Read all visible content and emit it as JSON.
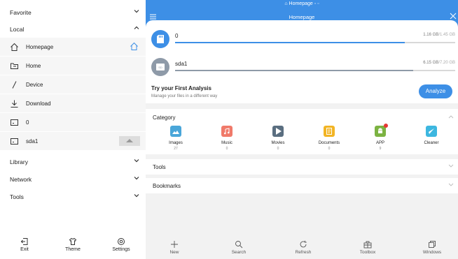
{
  "sidebar": {
    "favorite": "Favorite",
    "local": "Local",
    "items": [
      {
        "label": "Homepage",
        "icon": "home-icon"
      },
      {
        "label": "Home",
        "icon": "folder-icon"
      },
      {
        "label": "Device",
        "icon": "slash-icon"
      },
      {
        "label": "Download",
        "icon": "download-icon"
      },
      {
        "label": "0",
        "icon": "storage-icon"
      },
      {
        "label": "sda1",
        "icon": "storage-icon"
      }
    ],
    "library": "Library",
    "network": "Network",
    "tools": "Tools",
    "footer": {
      "exit": "Exit",
      "theme": "Theme",
      "settings": "Settings"
    }
  },
  "header": {
    "tab": "Homepage",
    "title": "Homepage"
  },
  "devices": [
    {
      "name": "0",
      "used": "1.16 GB",
      "total": "/1.45 GB",
      "fill": 0.82
    },
    {
      "name": "sda1",
      "used": "6.15 GB",
      "total": "/7.20 GB",
      "fill": 0.85
    }
  ],
  "analysis": {
    "title": "Try your First Analysis",
    "subtitle": "Manage your files in a different way",
    "button": "Analyze"
  },
  "category": {
    "title": "Category",
    "items": [
      {
        "label": "Images",
        "count": "27",
        "color": "#4aa6d9"
      },
      {
        "label": "Music",
        "count": "0",
        "color": "#f07a6a"
      },
      {
        "label": "Movies",
        "count": "0",
        "color": "#5a6e80"
      },
      {
        "label": "Documents",
        "count": "0",
        "color": "#f2b424"
      },
      {
        "label": "APP",
        "count": "9",
        "color": "#7cb342"
      },
      {
        "label": "Cleaner",
        "count": "",
        "color": "#3db7e0"
      }
    ]
  },
  "sections": {
    "tools": "Tools",
    "bookmarks": "Bookmarks"
  },
  "bottombar": {
    "new": "New",
    "search": "Search",
    "refresh": "Refresh",
    "toolbox": "Toolbox",
    "windows": "Windows"
  },
  "colors": {
    "accent": "#3d8fe6",
    "storage_green": "#d9534f"
  }
}
